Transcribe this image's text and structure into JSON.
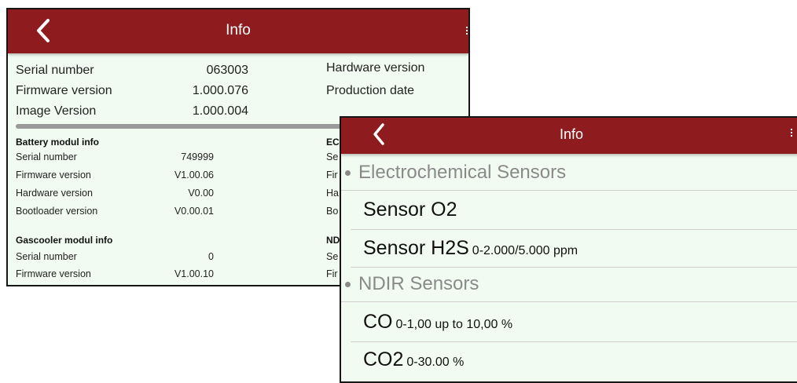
{
  "screen1": {
    "appbar": {
      "title": "Info"
    },
    "top_info": {
      "serial_number_label": "Serial number",
      "serial_number_value": "063003",
      "firmware_version_label": "Firmware version",
      "firmware_version_value": "1.000.076",
      "image_version_label": "Image Version",
      "image_version_value": "1.000.004",
      "hardware_version_label": "Hardware version",
      "production_date_label": "Production date"
    },
    "battery_module": {
      "heading": "Battery modul info",
      "rows": [
        {
          "label": "Serial number",
          "value": "749999"
        },
        {
          "label": "Firmware version",
          "value": "V1.00.06"
        },
        {
          "label": "Hardware version",
          "value": "V0.00"
        },
        {
          "label": "Bootloader version",
          "value": "V0.00.01"
        }
      ]
    },
    "gascooler_module": {
      "heading": "Gascooler modul info",
      "rows": [
        {
          "label": "Serial number",
          "value": "0"
        },
        {
          "label": "Firmware version",
          "value": "V1.00.10"
        }
      ]
    },
    "right_column_fragments": {
      "ec_heading": "EC",
      "ec_rows": [
        "Se",
        "Fir",
        "Ha",
        "Bo"
      ],
      "nd_heading": "ND",
      "nd_rows": [
        "Se",
        "Fir"
      ]
    }
  },
  "screen2": {
    "appbar": {
      "title": "Info"
    },
    "sections": [
      {
        "title": "Electrochemical Sensors",
        "items": [
          {
            "name": "Sensor O2",
            "range": ""
          },
          {
            "name": "Sensor H2S",
            "range": "0-2.000/5.000 ppm"
          }
        ]
      },
      {
        "title": "NDIR Sensors",
        "items": [
          {
            "name": "CO",
            "range": "0-1,00 up to 10,00 %"
          },
          {
            "name": "CO2",
            "range": "0-30.00 %"
          }
        ]
      }
    ]
  },
  "icons": {
    "back": "chevron-left-icon",
    "overflow": "more-vertical-icon"
  },
  "colors": {
    "appbar": "#8e1c1e",
    "background": "#f1fbf1",
    "section_text": "#8a8a8a"
  }
}
